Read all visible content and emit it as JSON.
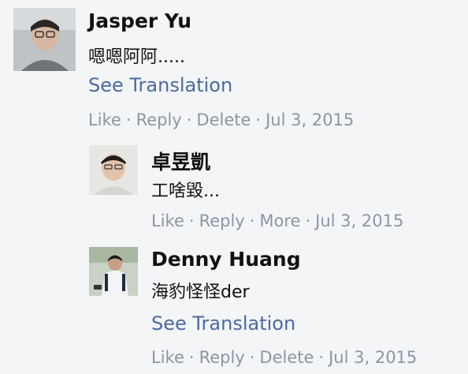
{
  "comments": [
    {
      "author": "Jasper Yu",
      "text": "嗯嗯阿阿.....",
      "translation": "See Translation",
      "actions": [
        "Like",
        "Reply",
        "Delete"
      ],
      "date": "Jul 3, 2015"
    },
    {
      "author": "卓昱凱",
      "text": "工啥毀...",
      "actions": [
        "Like",
        "Reply",
        "More"
      ],
      "date": "Jul 3, 2015"
    },
    {
      "author": "Denny Huang",
      "text": "海豹怪怪der",
      "translation": "See Translation",
      "actions": [
        "Like",
        "Reply",
        "Delete"
      ],
      "date": "Jul 3, 2015"
    }
  ],
  "separator": "·",
  "colors": {
    "background": "#f4f5f7",
    "link": "#4b6aa1",
    "meta": "#8d95a3",
    "text": "#111111"
  }
}
